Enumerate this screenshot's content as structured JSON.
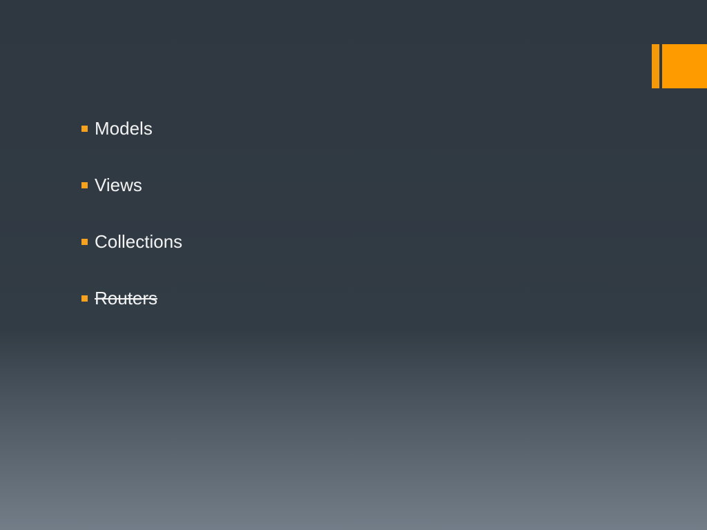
{
  "slide": {
    "bullets": [
      {
        "label": "Models",
        "struck": false
      },
      {
        "label": "Views",
        "struck": false
      },
      {
        "label": "Collections",
        "struck": false
      },
      {
        "label": "Routers",
        "struck": true
      }
    ]
  },
  "colors": {
    "accent": "#fe9b00",
    "bullet_marker": "#f7a21e",
    "text": "#f2f2f2",
    "background_top": "#2f3740",
    "background_bottom": "#737d88"
  }
}
